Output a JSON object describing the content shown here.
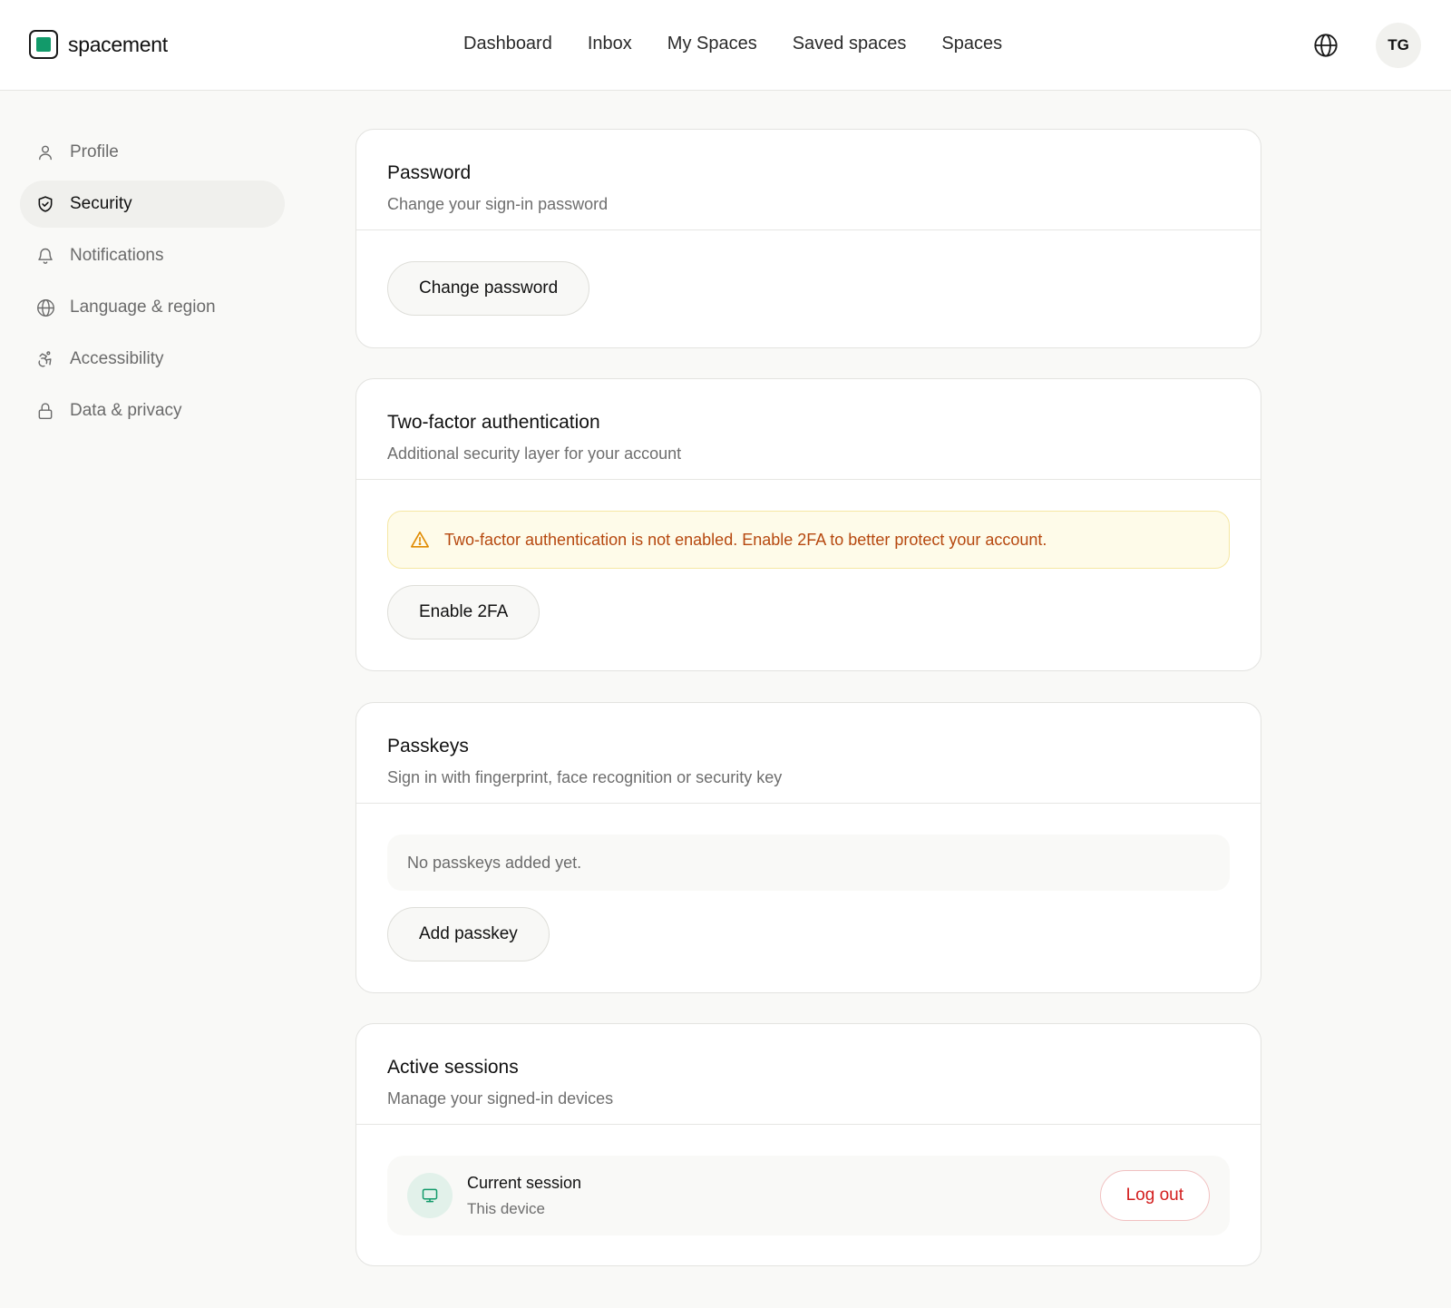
{
  "brand": {
    "name": "spacement",
    "accent": "#129a6a"
  },
  "nav": {
    "items": [
      {
        "label": "Dashboard"
      },
      {
        "label": "Inbox"
      },
      {
        "label": "My Spaces"
      },
      {
        "label": "Saved spaces"
      },
      {
        "label": "Spaces"
      }
    ]
  },
  "header": {
    "globe_icon": "globe-icon",
    "avatar_initials": "TG"
  },
  "sidebar": {
    "items": [
      {
        "label": "Profile",
        "icon": "user-icon",
        "active": false
      },
      {
        "label": "Security",
        "icon": "shield-icon",
        "active": true
      },
      {
        "label": "Notifications",
        "icon": "bell-icon",
        "active": false
      },
      {
        "label": "Language & region",
        "icon": "globe-icon",
        "active": false
      },
      {
        "label": "Accessibility",
        "icon": "accessibility-icon",
        "active": false
      },
      {
        "label": "Data & privacy",
        "icon": "lock-icon",
        "active": false
      }
    ]
  },
  "password": {
    "title": "Password",
    "subtitle": "Change your sign-in password",
    "button": "Change password"
  },
  "twofa": {
    "title": "Two-factor authentication",
    "subtitle": "Additional security layer for your account",
    "warning": "Two-factor authentication is not enabled. Enable 2FA to better protect your account.",
    "warning_color": "#b6480f",
    "button": "Enable 2FA"
  },
  "passkeys": {
    "title": "Passkeys",
    "subtitle": "Sign in with fingerprint, face recognition or security key",
    "empty": "No passkeys added yet.",
    "button": "Add passkey"
  },
  "sessions": {
    "title": "Active sessions",
    "subtitle": "Manage your signed-in devices",
    "current": {
      "title": "Current session",
      "subtitle": "This device",
      "icon": "monitor-icon"
    },
    "logout": "Log out",
    "logout_color": "#d31e1e"
  }
}
